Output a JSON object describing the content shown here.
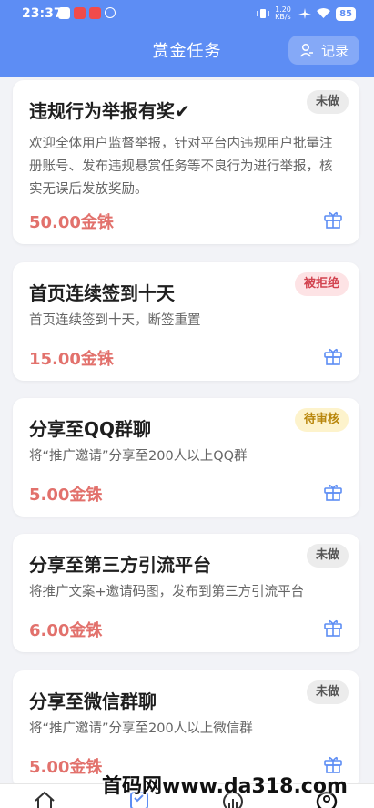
{
  "status": {
    "time": "23:37",
    "battery": "85",
    "net": "1.20\nKB/s"
  },
  "header": {
    "title": "赏金任务",
    "record_label": "记录"
  },
  "tasks": [
    {
      "title": "违规行为举报有奖✔",
      "status": "未做",
      "desc": "欢迎全体用户监督举报，针对平台内违规用户批量注册账号、发布违规悬赏任务等不良行为进行举报，核实无误后发放奖励。",
      "reward": "50.00金铢"
    },
    {
      "title": "首页连续签到十天",
      "status": "被拒绝",
      "desc": "首页连续签到十天，断签重置",
      "reward": "15.00金铢"
    },
    {
      "title": "分享至QQ群聊",
      "status": "待审核",
      "desc": "将“推广邀请”分享至200人以上QQ群",
      "reward": "5.00金铢"
    },
    {
      "title": "分享至第三方引流平台",
      "status": "未做",
      "desc": "将推广文案+邀请码图，发布到第三方引流平台",
      "reward": "6.00金铢"
    },
    {
      "title": "分享至微信群聊",
      "status": "未做",
      "desc": "将“推广邀请”分享至200人以上微信群",
      "reward": "5.00金铢"
    }
  ],
  "watermark": "首码网www.da318.com",
  "colors": {
    "header": "#5d8df4",
    "reward": "#e2716c",
    "accent": "#5d8df4"
  }
}
